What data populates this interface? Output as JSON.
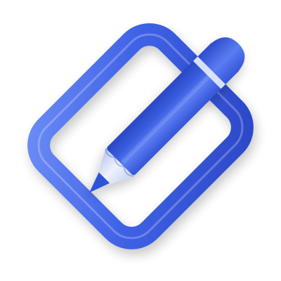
{
  "icon": {
    "name": "edit-pencil-over-rounded-square-icon",
    "colors": {
      "background": "#ffffff",
      "frame": "#3b5fe3",
      "frame_highlight": "#5f80f4",
      "frame_shadow": "#2a45c2",
      "pencil_body": "#3a5de0",
      "pencil_body_light": "#5b7ef3",
      "pencil_body_dark": "#2947c4",
      "pencil_band": "#d7e1ff",
      "pencil_wood": "#dfe5f6",
      "pencil_lead": "#2f52d8"
    }
  }
}
